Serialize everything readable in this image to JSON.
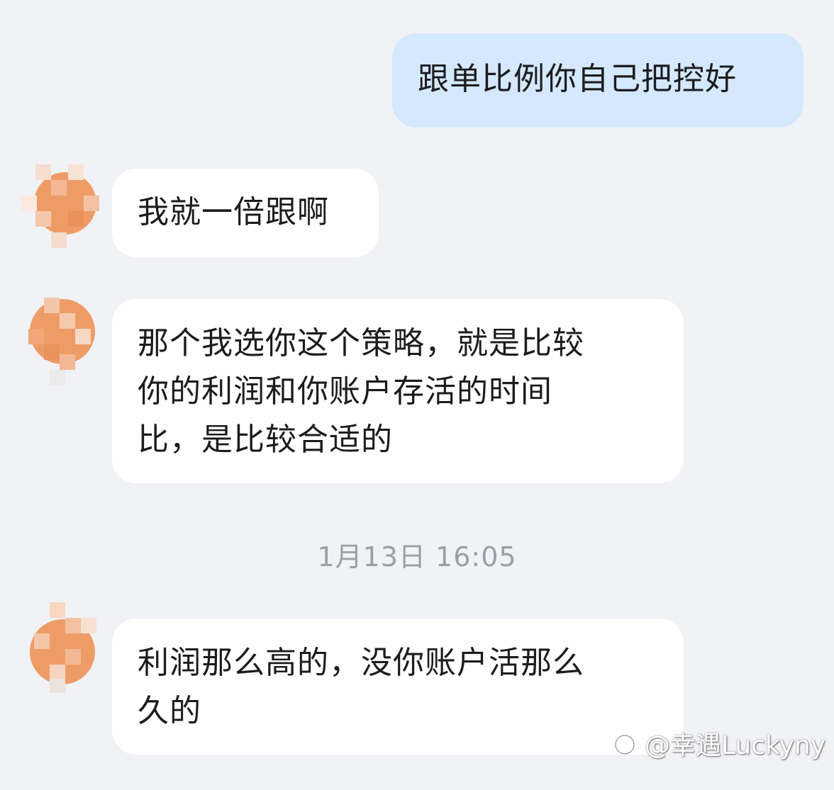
{
  "messages": [
    {
      "side": "out",
      "lines": [
        "跟单比例你自己把控好"
      ]
    },
    {
      "side": "in",
      "lines": [
        "我就一倍跟啊"
      ]
    },
    {
      "side": "in",
      "lines": [
        "那个我选你这个策略，就是比较",
        "你的利润和你账户存活的时间",
        "比，是比较合适的"
      ]
    },
    {
      "side": "in",
      "lines": [
        "利润那么高的，没你账户活那么",
        "久的"
      ]
    }
  ],
  "timestamp": "1月13日 16:05",
  "watermark": {
    "text": "@幸遇Luckyny",
    "icon": "weibo-icon"
  },
  "colors": {
    "background": "#f1f2f6",
    "outgoing_bubble": "#d4e8ff",
    "incoming_bubble": "#ffffff",
    "avatar": "#ee9c66",
    "timestamp": "#9b9ea6"
  }
}
